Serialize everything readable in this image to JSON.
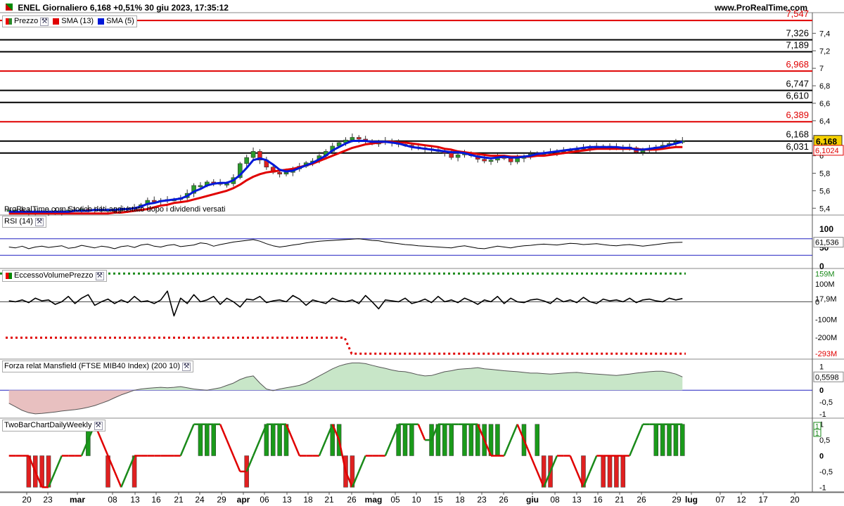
{
  "header": {
    "title": "ENEL Giornaliero 6,168 +0,51% 30 giu 2023, 17:35:12",
    "site": "www.ProRealTime.com"
  },
  "note": "ProRealTime.com Storico dati aggiustato dopo i dividendi versati",
  "panels": {
    "price": {
      "legend": [
        {
          "label": "Prezzo",
          "color": "#2a8a2a",
          "icon": "wrench-icon"
        },
        {
          "label": "SMA (13)",
          "color": "#e00000"
        },
        {
          "label": "SMA (5)",
          "color": "#0018d8"
        }
      ]
    },
    "rsi": {
      "legend": "RSI (14)"
    },
    "volume": {
      "legend": "EccessoVolumePrezzo"
    },
    "mansfield": {
      "legend": "Forza relat Mansfield (FTSE MIB40 Index) (200 10)"
    },
    "twobar": {
      "legend": "TwoBarChartDailyWeekly"
    }
  },
  "chart_data": [
    {
      "type": "candlestick",
      "panel": "price",
      "x_ticks": [
        "20",
        "23",
        "mar",
        "08",
        "13",
        "16",
        "21",
        "24",
        "29",
        "apr",
        "06",
        "13",
        "18",
        "21",
        "26",
        "mag",
        "05",
        "10",
        "15",
        "18",
        "23",
        "26",
        "giu",
        "08",
        "13",
        "16",
        "21",
        "26",
        "29",
        "lug",
        "07",
        "12",
        "17",
        "20"
      ],
      "y_ticks": [
        "5,4",
        "5,6",
        "5,8",
        "6",
        "6,2",
        "6,4",
        "6,6",
        "6,8",
        "7",
        "7,2",
        "7,4",
        "7,6"
      ],
      "ylim": [
        5.33,
        7.62
      ],
      "levels": [
        {
          "label": "7,547",
          "value": 7.547,
          "color": "#e00000"
        },
        {
          "label": "7,326",
          "value": 7.326,
          "color": "#000000"
        },
        {
          "label": "7,189",
          "value": 7.189,
          "color": "#000000"
        },
        {
          "label": "6,968",
          "value": 6.968,
          "color": "#e00000"
        },
        {
          "label": "6,747",
          "value": 6.747,
          "color": "#000000"
        },
        {
          "label": "6,610",
          "value": 6.61,
          "color": "#000000"
        },
        {
          "label": "6,389",
          "value": 6.389,
          "color": "#e00000"
        },
        {
          "label": "6,168",
          "value": 6.168,
          "color": "#000000"
        },
        {
          "label": "6,031",
          "value": 6.031,
          "color": "#000000"
        }
      ],
      "last_price": {
        "label": "6,168",
        "value": 6.168
      },
      "sma13_last": {
        "label": "6,1024",
        "value": 6.1024
      },
      "up_color": "#2a9a2a",
      "down_color": "#e02020",
      "close": [
        5.38,
        5.38,
        5.37,
        5.36,
        5.35,
        5.36,
        5.35,
        5.36,
        5.37,
        5.38,
        5.38,
        5.39,
        5.38,
        5.39,
        5.37,
        5.38,
        5.38,
        5.39,
        5.4,
        5.41,
        5.44,
        5.49,
        5.48,
        5.49,
        5.5,
        5.5,
        5.52,
        5.57,
        5.66,
        5.66,
        5.7,
        5.69,
        5.68,
        5.68,
        5.75,
        5.91,
        5.98,
        6.05,
        5.95,
        5.87,
        5.81,
        5.79,
        5.81,
        5.85,
        5.88,
        5.92,
        5.94,
        6.0,
        6.05,
        6.11,
        6.15,
        6.18,
        6.21,
        6.19,
        6.17,
        6.14,
        6.15,
        6.17,
        6.15,
        6.13,
        6.12,
        6.1,
        6.09,
        6.08,
        6.07,
        6.05,
        6.03,
        5.98,
        6.01,
        6.03,
        6.0,
        5.96,
        5.94,
        5.95,
        5.99,
        5.97,
        5.93,
        5.97,
        5.99,
        6.02,
        6.03,
        6.03,
        6.04,
        6.05,
        6.06,
        6.07,
        6.08,
        6.09,
        6.1,
        6.11,
        6.11,
        6.1,
        6.09,
        6.1,
        6.09,
        6.04,
        6.06,
        6.08,
        6.1,
        6.12,
        6.14,
        6.16,
        6.17
      ],
      "sma13": [
        5.34,
        5.34,
        5.34,
        5.34,
        5.34,
        5.34,
        5.34,
        5.34,
        5.34,
        5.34,
        5.34,
        5.34,
        5.34,
        5.34,
        5.34,
        5.34,
        5.35,
        5.35,
        5.36,
        5.37,
        5.38,
        5.39,
        5.41,
        5.43,
        5.44,
        5.46,
        5.47,
        5.48,
        5.5,
        5.52,
        5.54,
        5.56,
        5.58,
        5.6,
        5.63,
        5.67,
        5.72,
        5.76,
        5.79,
        5.81,
        5.82,
        5.83,
        5.84,
        5.85,
        5.87,
        5.89,
        5.91,
        5.94,
        5.97,
        6.0,
        6.03,
        6.06,
        6.09,
        6.11,
        6.13,
        6.14,
        6.15,
        6.16,
        6.16,
        6.15,
        6.15,
        6.14,
        6.13,
        6.12,
        6.11,
        6.1,
        6.08,
        6.07,
        6.05,
        6.04,
        6.03,
        6.02,
        6.01,
        6.0,
        6.0,
        6.0,
        5.99,
        5.99,
        5.99,
        5.99,
        6.0,
        6.0,
        6.01,
        6.02,
        6.03,
        6.04,
        6.05,
        6.06,
        6.07,
        6.08,
        6.08,
        6.08,
        6.08,
        6.08,
        6.08,
        6.08,
        6.07,
        6.07,
        6.07,
        6.08,
        6.09,
        6.1,
        6.1
      ],
      "sma5": [
        5.36,
        5.36,
        5.36,
        5.36,
        5.36,
        5.36,
        5.36,
        5.36,
        5.36,
        5.36,
        5.37,
        5.37,
        5.37,
        5.38,
        5.38,
        5.38,
        5.38,
        5.39,
        5.39,
        5.4,
        5.42,
        5.45,
        5.46,
        5.48,
        5.49,
        5.5,
        5.51,
        5.54,
        5.59,
        5.62,
        5.66,
        5.68,
        5.69,
        5.69,
        5.72,
        5.78,
        5.86,
        5.95,
        5.97,
        5.95,
        5.9,
        5.84,
        5.82,
        5.83,
        5.86,
        5.89,
        5.92,
        5.96,
        6.0,
        6.06,
        6.1,
        6.14,
        6.17,
        6.17,
        6.17,
        6.16,
        6.16,
        6.16,
        6.15,
        6.14,
        6.12,
        6.1,
        6.09,
        6.08,
        6.07,
        6.06,
        6.05,
        6.04,
        6.04,
        6.03,
        6.01,
        5.99,
        5.98,
        5.97,
        5.98,
        5.99,
        5.98,
        5.98,
        5.99,
        6.0,
        6.02,
        6.03,
        6.04,
        6.05,
        6.06,
        6.07,
        6.08,
        6.09,
        6.1,
        6.1,
        6.1,
        6.1,
        6.1,
        6.09,
        6.09,
        6.07,
        6.07,
        6.08,
        6.09,
        6.1,
        6.12,
        6.14,
        6.16
      ]
    },
    {
      "type": "line",
      "panel": "rsi",
      "y_ticks": [
        "100",
        "50",
        "0"
      ],
      "ylim": [
        0,
        100
      ],
      "overbought": 70,
      "oversold": 30,
      "last": {
        "label": "61,536",
        "value": 61.536
      },
      "values": [
        50,
        48,
        52,
        46,
        50,
        52,
        49,
        51,
        53,
        47,
        49,
        54,
        51,
        48,
        52,
        50,
        46,
        51,
        53,
        49,
        55,
        57,
        52,
        50,
        54,
        56,
        51,
        53,
        55,
        60,
        58,
        52,
        56,
        59,
        62,
        64,
        66,
        68,
        64,
        58,
        53,
        50,
        52,
        55,
        57,
        60,
        62,
        64,
        65,
        66,
        67,
        68,
        69,
        70,
        68,
        66,
        65,
        62,
        60,
        58,
        56,
        55,
        53,
        52,
        51,
        50,
        49,
        48,
        51,
        53,
        50,
        47,
        46,
        49,
        52,
        50,
        48,
        51,
        53,
        54,
        56,
        57,
        56,
        55,
        57,
        59,
        58,
        56,
        57,
        58,
        56,
        54,
        53,
        55,
        56,
        54,
        52,
        54,
        56,
        58,
        60,
        61,
        61.5
      ]
    },
    {
      "type": "line",
      "panel": "volume",
      "y_ticks": [
        "159M",
        "100M",
        "17,9M",
        "0",
        "-100M",
        "-200M",
        "-293M"
      ],
      "ylim": [
        -320,
        180
      ],
      "upper_band": {
        "label": "159M",
        "value": 159
      },
      "lower_band": {
        "label": "-293M",
        "value": -293
      },
      "last": {
        "label": "17,9M",
        "value": 17.9
      },
      "values": [
        5,
        0,
        10,
        -5,
        20,
        5,
        10,
        -15,
        0,
        30,
        -10,
        20,
        40,
        -20,
        0,
        15,
        -10,
        10,
        -5,
        30,
        0,
        5,
        -10,
        10,
        60,
        -80,
        20,
        -10,
        40,
        0,
        10,
        30,
        -15,
        20,
        0,
        -30,
        15,
        10,
        30,
        -5,
        5,
        10,
        0,
        35,
        15,
        -20,
        10,
        0,
        -10,
        20,
        5,
        0,
        10,
        -10,
        35,
        0,
        -40,
        10,
        5,
        0,
        20,
        -10,
        0,
        15,
        -5,
        30,
        0,
        10,
        -5,
        20,
        5,
        -15,
        10,
        0,
        30,
        -10,
        20,
        0,
        -5,
        10,
        15,
        5,
        -10,
        20,
        0,
        10,
        -5,
        25,
        0,
        -10,
        15,
        5,
        10,
        0,
        20,
        -5,
        10,
        15,
        5,
        0,
        20,
        10,
        17.9
      ]
    },
    {
      "type": "area",
      "panel": "mansfield",
      "y_ticks": [
        "1",
        "0,5",
        "0",
        "-0,5",
        "-1"
      ],
      "ylim": [
        -1.15,
        1.25
      ],
      "last": {
        "label": "0,5598",
        "value": 0.5598
      },
      "positive_color": "#c8e6c8",
      "negative_color": "#e8c0c0",
      "values": [
        -0.55,
        -0.7,
        -0.85,
        -0.95,
        -1.0,
        -0.98,
        -0.95,
        -0.92,
        -0.88,
        -0.85,
        -0.82,
        -0.78,
        -0.72,
        -0.65,
        -0.55,
        -0.45,
        -0.32,
        -0.2,
        -0.1,
        0.0,
        0.05,
        0.08,
        0.1,
        0.12,
        0.1,
        0.12,
        0.15,
        0.1,
        0.05,
        0.02,
        0.0,
        0.05,
        0.1,
        0.2,
        0.3,
        0.45,
        0.55,
        0.6,
        0.3,
        0.05,
        -0.02,
        0.05,
        0.1,
        0.15,
        0.2,
        0.3,
        0.45,
        0.6,
        0.75,
        0.9,
        1.02,
        1.1,
        1.15,
        1.15,
        1.12,
        1.05,
        0.98,
        0.92,
        0.85,
        0.8,
        0.78,
        0.72,
        0.65,
        0.6,
        0.62,
        0.7,
        0.78,
        0.82,
        0.88,
        0.9,
        0.92,
        0.95,
        0.9,
        0.88,
        0.85,
        0.82,
        0.8,
        0.78,
        0.75,
        0.72,
        0.72,
        0.7,
        0.68,
        0.7,
        0.72,
        0.74,
        0.75,
        0.72,
        0.7,
        0.68,
        0.66,
        0.64,
        0.62,
        0.65,
        0.68,
        0.72,
        0.75,
        0.78,
        0.8,
        0.8,
        0.75,
        0.68,
        0.56
      ]
    },
    {
      "type": "bar",
      "panel": "twobar",
      "y_ticks": [
        "1",
        "0,5",
        "0",
        "-0,5",
        "-1"
      ],
      "ylim": [
        -1.15,
        1.15
      ],
      "last": [
        {
          "label": "1",
          "value": 1
        },
        {
          "label": "1",
          "value": 1
        }
      ],
      "values": [
        0,
        0,
        0,
        -1,
        -1,
        -1,
        -1,
        0,
        0,
        0,
        0,
        0,
        1,
        0,
        0,
        -1,
        0,
        0,
        0,
        -1,
        0,
        0,
        0,
        0,
        0,
        0,
        0,
        0,
        0,
        1,
        1,
        1,
        0,
        0,
        0,
        0,
        -1,
        0,
        0,
        1,
        1,
        1,
        1,
        0,
        0,
        0,
        0,
        0,
        0,
        1,
        1,
        -1,
        -1,
        0,
        0,
        0,
        0,
        0,
        0,
        1,
        1,
        1,
        0,
        0,
        1,
        1,
        1,
        1,
        0,
        1,
        1,
        1,
        1,
        1,
        1,
        0,
        0,
        0,
        1,
        0,
        1,
        -1,
        -1,
        0,
        0,
        0,
        0,
        -1,
        0,
        0,
        -1,
        -1,
        -1,
        -1,
        0,
        0,
        0,
        0,
        1,
        1,
        1,
        1,
        1
      ],
      "line": [
        0,
        0,
        0,
        0,
        -0.5,
        -1,
        -1,
        -0.5,
        0,
        0,
        0,
        0,
        0.5,
        1,
        0.5,
        0,
        -0.5,
        -1,
        -0.5,
        0,
        0,
        0,
        0,
        0,
        0,
        0,
        0,
        0.5,
        1,
        1,
        1,
        1,
        1,
        0.5,
        0,
        -0.5,
        -0.5,
        0,
        0.5,
        1,
        1,
        1,
        1,
        0.5,
        0,
        0,
        0,
        0,
        0.5,
        1,
        0.5,
        -0.5,
        -1,
        -0.5,
        0,
        0,
        0,
        0,
        0.5,
        1,
        1,
        1,
        1,
        0.5,
        0.5,
        1,
        1,
        1,
        1,
        1,
        1,
        1,
        0.5,
        0,
        0,
        0,
        0.5,
        1,
        0.5,
        0,
        -0.5,
        -1,
        -0.5,
        0,
        0,
        0,
        -0.5,
        -1,
        -0.5,
        0,
        0,
        0,
        0,
        0,
        0,
        0.5,
        1,
        1,
        1,
        1,
        1,
        1,
        1
      ]
    }
  ]
}
